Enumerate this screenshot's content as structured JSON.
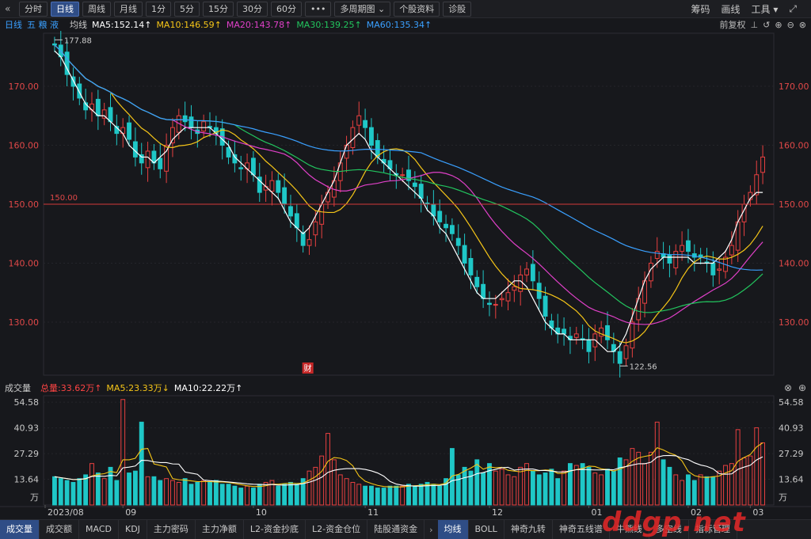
{
  "toolbar": {
    "back_icon": "double-chevron-left-icon",
    "tabs": [
      "分时",
      "日线",
      "周线",
      "月线",
      "1分",
      "5分",
      "15分",
      "30分",
      "60分",
      "•••",
      "多周期图 ⌄",
      "个股资料",
      "诊股"
    ],
    "active_tab": "日线",
    "right_items": [
      "筹码",
      "画线",
      "工具 ▾"
    ],
    "expand_icon": "expand-icon"
  },
  "ma_header": {
    "period": "日线",
    "stock_name": "五 粮 液",
    "avg_label": "均线",
    "ma5": "MA5:152.14↑",
    "ma10": "MA10:146.59↑",
    "ma20": "MA20:143.78↑",
    "ma30": "MA30:139.25↑",
    "ma60": "MA60:135.34↑",
    "adjust": "前复权",
    "colors": {
      "ma5": "#ffffff",
      "ma10": "#f5c518",
      "ma20": "#e040c8",
      "ma30": "#22c55e",
      "ma60": "#3aa0ff"
    }
  },
  "price_axis": {
    "labels": [
      "170.00",
      "160.00",
      "150.00",
      "140.00",
      "130.00"
    ]
  },
  "annotations": {
    "high": "177.88",
    "low": "122.56",
    "ref_line": "150.00",
    "event": "财"
  },
  "volume_header": {
    "title": "成交量",
    "total": "总量:33.62万↑",
    "ma5": "MA5:23.33万↓",
    "ma10": "MA10:22.22万↑"
  },
  "volume_axis": {
    "labels": [
      "54.58",
      "40.93",
      "27.29",
      "13.64",
      "万"
    ]
  },
  "date_axis": {
    "labels": [
      "2023/08",
      "09",
      "10",
      "11",
      "12",
      "01",
      "02",
      "03"
    ]
  },
  "bottom_tabs": [
    "成交量",
    "成交额",
    "MACD",
    "KDJ",
    "主力密码",
    "主力净额",
    "L2-资金抄底",
    "L2-资金仓位",
    "陆股通资金",
    "均线",
    "BOLL",
    "神奇九转",
    "神奇五线谱",
    "牛熊线",
    "多空线",
    "指标管理"
  ],
  "bottom_active": [
    "成交量",
    "均线"
  ],
  "watermark": "ddgp.net",
  "chart_data": {
    "type": "candlestick",
    "ylim": [
      121,
      179
    ],
    "ref_value": 150,
    "closes": [
      177,
      175,
      172,
      170,
      168,
      166,
      167,
      165,
      166,
      164,
      162,
      163,
      161,
      158,
      157,
      159,
      157,
      156,
      160,
      163,
      165,
      164,
      163,
      162,
      164,
      163,
      162,
      160,
      158,
      157,
      156,
      157,
      155,
      152,
      153,
      154,
      152,
      150,
      148,
      146,
      143,
      144,
      147,
      150,
      152,
      154,
      157,
      160,
      163,
      165,
      163,
      160,
      158,
      157,
      156,
      155,
      155,
      154,
      153,
      151,
      150,
      148,
      147,
      146,
      145,
      143,
      140,
      138,
      136,
      134,
      133,
      133,
      134,
      135,
      136,
      138,
      139,
      137,
      134,
      131,
      129,
      128,
      128,
      127,
      128,
      127,
      125,
      128,
      129,
      127,
      125,
      123,
      126,
      130,
      134,
      137,
      140,
      142,
      141,
      140,
      142,
      143,
      142,
      141,
      141,
      140,
      138,
      139,
      141,
      143,
      147,
      150,
      152,
      155,
      158
    ],
    "volumes_wan": [
      15,
      14,
      13,
      12,
      14,
      16,
      22,
      17,
      14,
      20,
      13,
      56,
      17,
      18,
      44,
      15,
      15,
      13,
      14,
      13,
      12,
      14,
      11,
      12,
      13,
      12,
      13,
      11,
      11,
      10,
      9,
      10,
      9,
      11,
      12,
      13,
      10,
      11,
      12,
      11,
      14,
      18,
      20,
      26,
      38,
      24,
      16,
      14,
      12,
      11,
      10,
      10,
      9,
      9,
      10,
      10,
      10,
      11,
      10,
      11,
      12,
      11,
      10,
      14,
      30,
      16,
      20,
      18,
      24,
      17,
      22,
      18,
      19,
      16,
      15,
      20,
      22,
      18,
      16,
      17,
      19,
      14,
      18,
      22,
      21,
      22,
      20,
      17,
      16,
      19,
      18,
      25,
      24,
      30,
      28,
      22,
      28,
      44,
      24,
      20,
      16,
      13,
      16,
      13,
      16,
      15,
      15,
      18,
      21,
      22,
      40,
      25,
      26,
      41,
      33
    ],
    "ma5": [
      176,
      175,
      173,
      171,
      169,
      167,
      166,
      165,
      165,
      164,
      163,
      162,
      160,
      159,
      158,
      158,
      157,
      158,
      159,
      161,
      162,
      163,
      163,
      163,
      163,
      163,
      162,
      161,
      160,
      158,
      157,
      156,
      155,
      154,
      153,
      152,
      151,
      149,
      147,
      146,
      145,
      146,
      148,
      150,
      152,
      154,
      157,
      160,
      161,
      162,
      161,
      159,
      158,
      157,
      156,
      155,
      154,
      153,
      152,
      151,
      149,
      148,
      146,
      145,
      143,
      141,
      139,
      137,
      135,
      134,
      134,
      134,
      135,
      136,
      137,
      137,
      136,
      134,
      132,
      130,
      129,
      128,
      128,
      127,
      127,
      127,
      127,
      127,
      126,
      125,
      125,
      126,
      128,
      131,
      134,
      137,
      139,
      140,
      141,
      141,
      141,
      141,
      141,
      140,
      140,
      140,
      140,
      141,
      142,
      144,
      147,
      149,
      151,
      152,
      152
    ]
  }
}
